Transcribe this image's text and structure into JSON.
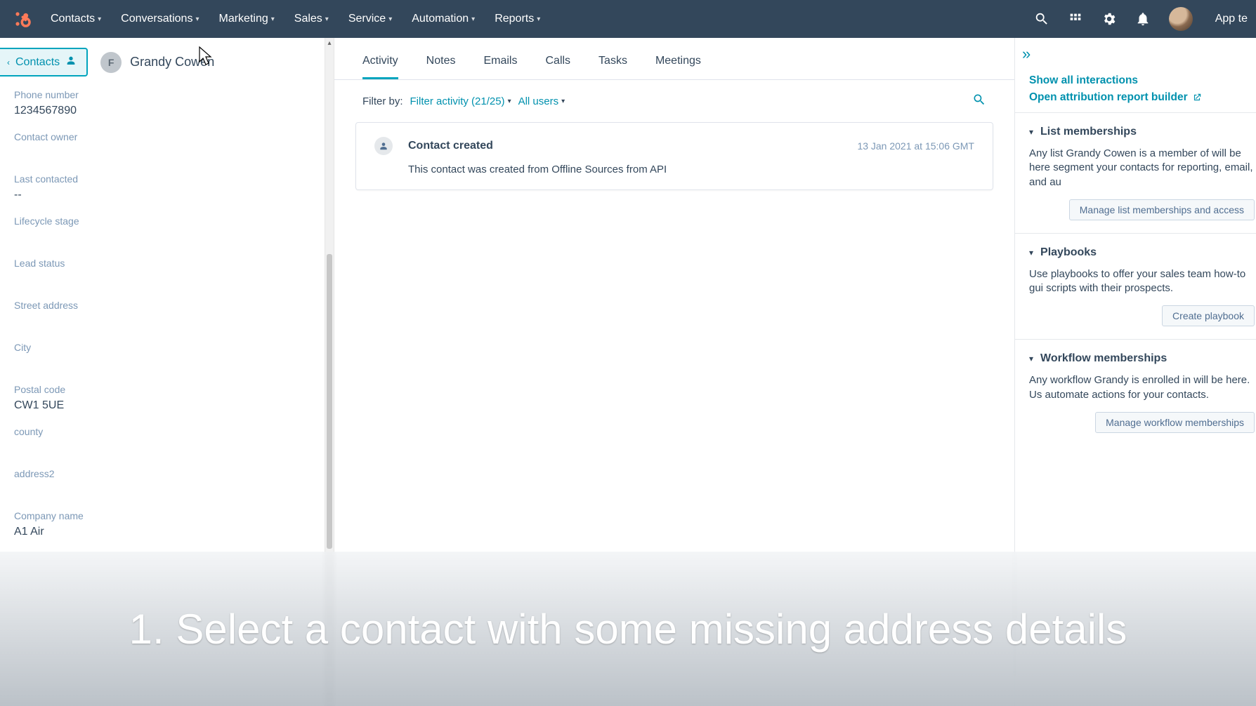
{
  "nav": {
    "items": [
      "Contacts",
      "Conversations",
      "Marketing",
      "Sales",
      "Service",
      "Automation",
      "Reports"
    ],
    "app_label": "App te"
  },
  "left": {
    "back_label": "Contacts",
    "contact_initial": "F",
    "contact_name": "Grandy Cowen",
    "props": [
      {
        "label": "Phone number",
        "value": "1234567890"
      },
      {
        "label": "Contact owner",
        "value": ""
      },
      {
        "label": "Last contacted",
        "value": "--"
      },
      {
        "label": "Lifecycle stage",
        "value": ""
      },
      {
        "label": "Lead status",
        "value": ""
      },
      {
        "label": "Street address",
        "value": ""
      },
      {
        "label": "City",
        "value": ""
      },
      {
        "label": "Postal code",
        "value": "CW1 5UE"
      },
      {
        "label": "county",
        "value": ""
      },
      {
        "label": "address2",
        "value": ""
      },
      {
        "label": "Company name",
        "value": "A1 Air"
      }
    ]
  },
  "mid": {
    "tabs": [
      "Activity",
      "Notes",
      "Emails",
      "Calls",
      "Tasks",
      "Meetings"
    ],
    "active_tab": 0,
    "filter_prefix": "Filter by:",
    "filter_activity": "Filter activity (21/25)",
    "filter_users": "All users",
    "event": {
      "title": "Contact created",
      "body": "This contact was created from Offline Sources from API",
      "time": "13 Jan 2021 at 15:06 GMT"
    }
  },
  "right": {
    "link_show_all": "Show all interactions",
    "link_attr": "Open attribution report builder",
    "sections": [
      {
        "title": "List memberships",
        "desc": "Any list Grandy Cowen is a member of will be here segment your contacts for reporting, email, and au",
        "button": "Manage list memberships and access"
      },
      {
        "title": "Playbooks",
        "desc": "Use playbooks to offer your sales team how-to gui scripts with their prospects.",
        "button": "Create playbook"
      },
      {
        "title": "Workflow memberships",
        "desc": "Any workflow Grandy is enrolled in will be here. Us automate actions for your contacts.",
        "button": "Manage workflow memberships"
      }
    ]
  },
  "banner": "1. Select a contact with some missing address details",
  "colors": {
    "accent": "#00a4bd",
    "brand": "#ff7a59",
    "navbg": "#33475b"
  }
}
